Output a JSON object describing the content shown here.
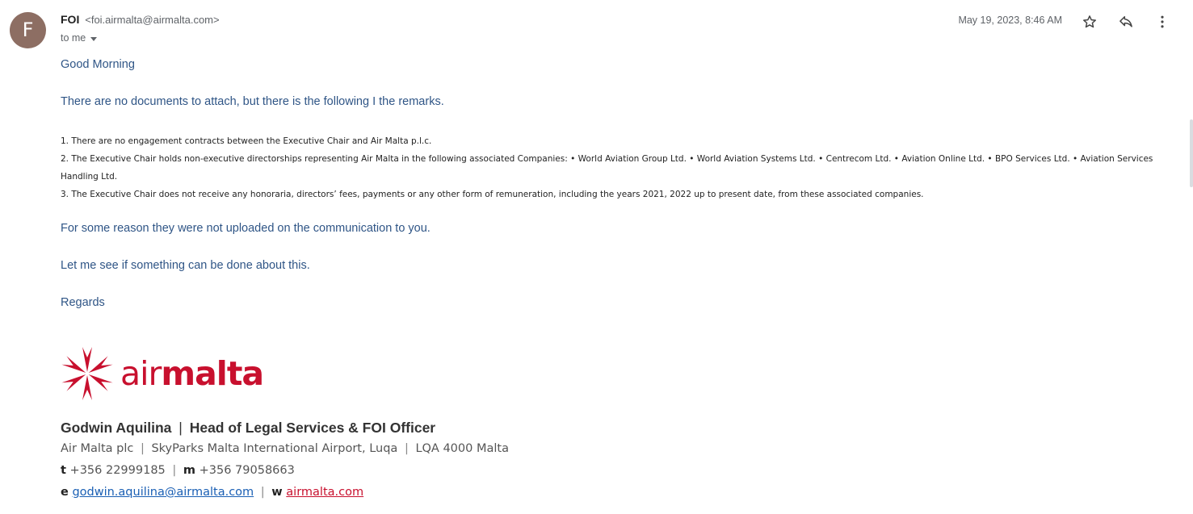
{
  "header": {
    "avatar_letter": "F",
    "sender_name": "FOI",
    "sender_email": "<foi.airmalta@airmalta.com>",
    "recipient": "to me",
    "date": "May 19, 2023, 8:46 AM",
    "icons": [
      "star-icon",
      "reply-icon",
      "more-vert-icon"
    ]
  },
  "message": {
    "greeting": "Good Morning",
    "intro": "There are no documents to attach, but there is the following I the remarks.",
    "remarks": [
      "1. There are no engagement contracts between the Executive Chair and Air Malta p.l.c.",
      "2. The Executive Chair holds non-executive directorships representing Air Malta in the following associated Companies: • World Aviation Group Ltd. • World Aviation Systems Ltd. • Centrecom Ltd. • Aviation Online Ltd. • BPO Services Ltd. • Aviation Services Handling Ltd.",
      "3. The Executive Chair does not receive any honoraria, directors’ fees, payments or any other form of remuneration, including the years 2021, 2022 up to present date, from these associated companies."
    ],
    "reason": "For some reason they were not uploaded on the communication to you.",
    "let_me_see": "Let me see if something can be done about this.",
    "regards": "Regards"
  },
  "signature": {
    "logo_text_light": "air",
    "logo_text_bold": "malta",
    "name": "Godwin Aquilina",
    "title": "Head of Legal Services & FOI Officer",
    "company": "Air Malta plc",
    "address": "SkyParks Malta International Airport, Luqa",
    "postcode": "LQA 4000 Malta",
    "tel_label": "t",
    "tel": "+356 22999185",
    "mobile_label": "m",
    "mobile": "+356 79058663",
    "email_label": "e",
    "email": "godwin.aquilina@airmalta.com",
    "web_label": "w",
    "web": "airmalta.com",
    "separator": "|"
  },
  "colors": {
    "body_text_blue": "#2f5586",
    "brand_red": "#c8102e",
    "avatar_bg": "#8d6e63"
  }
}
